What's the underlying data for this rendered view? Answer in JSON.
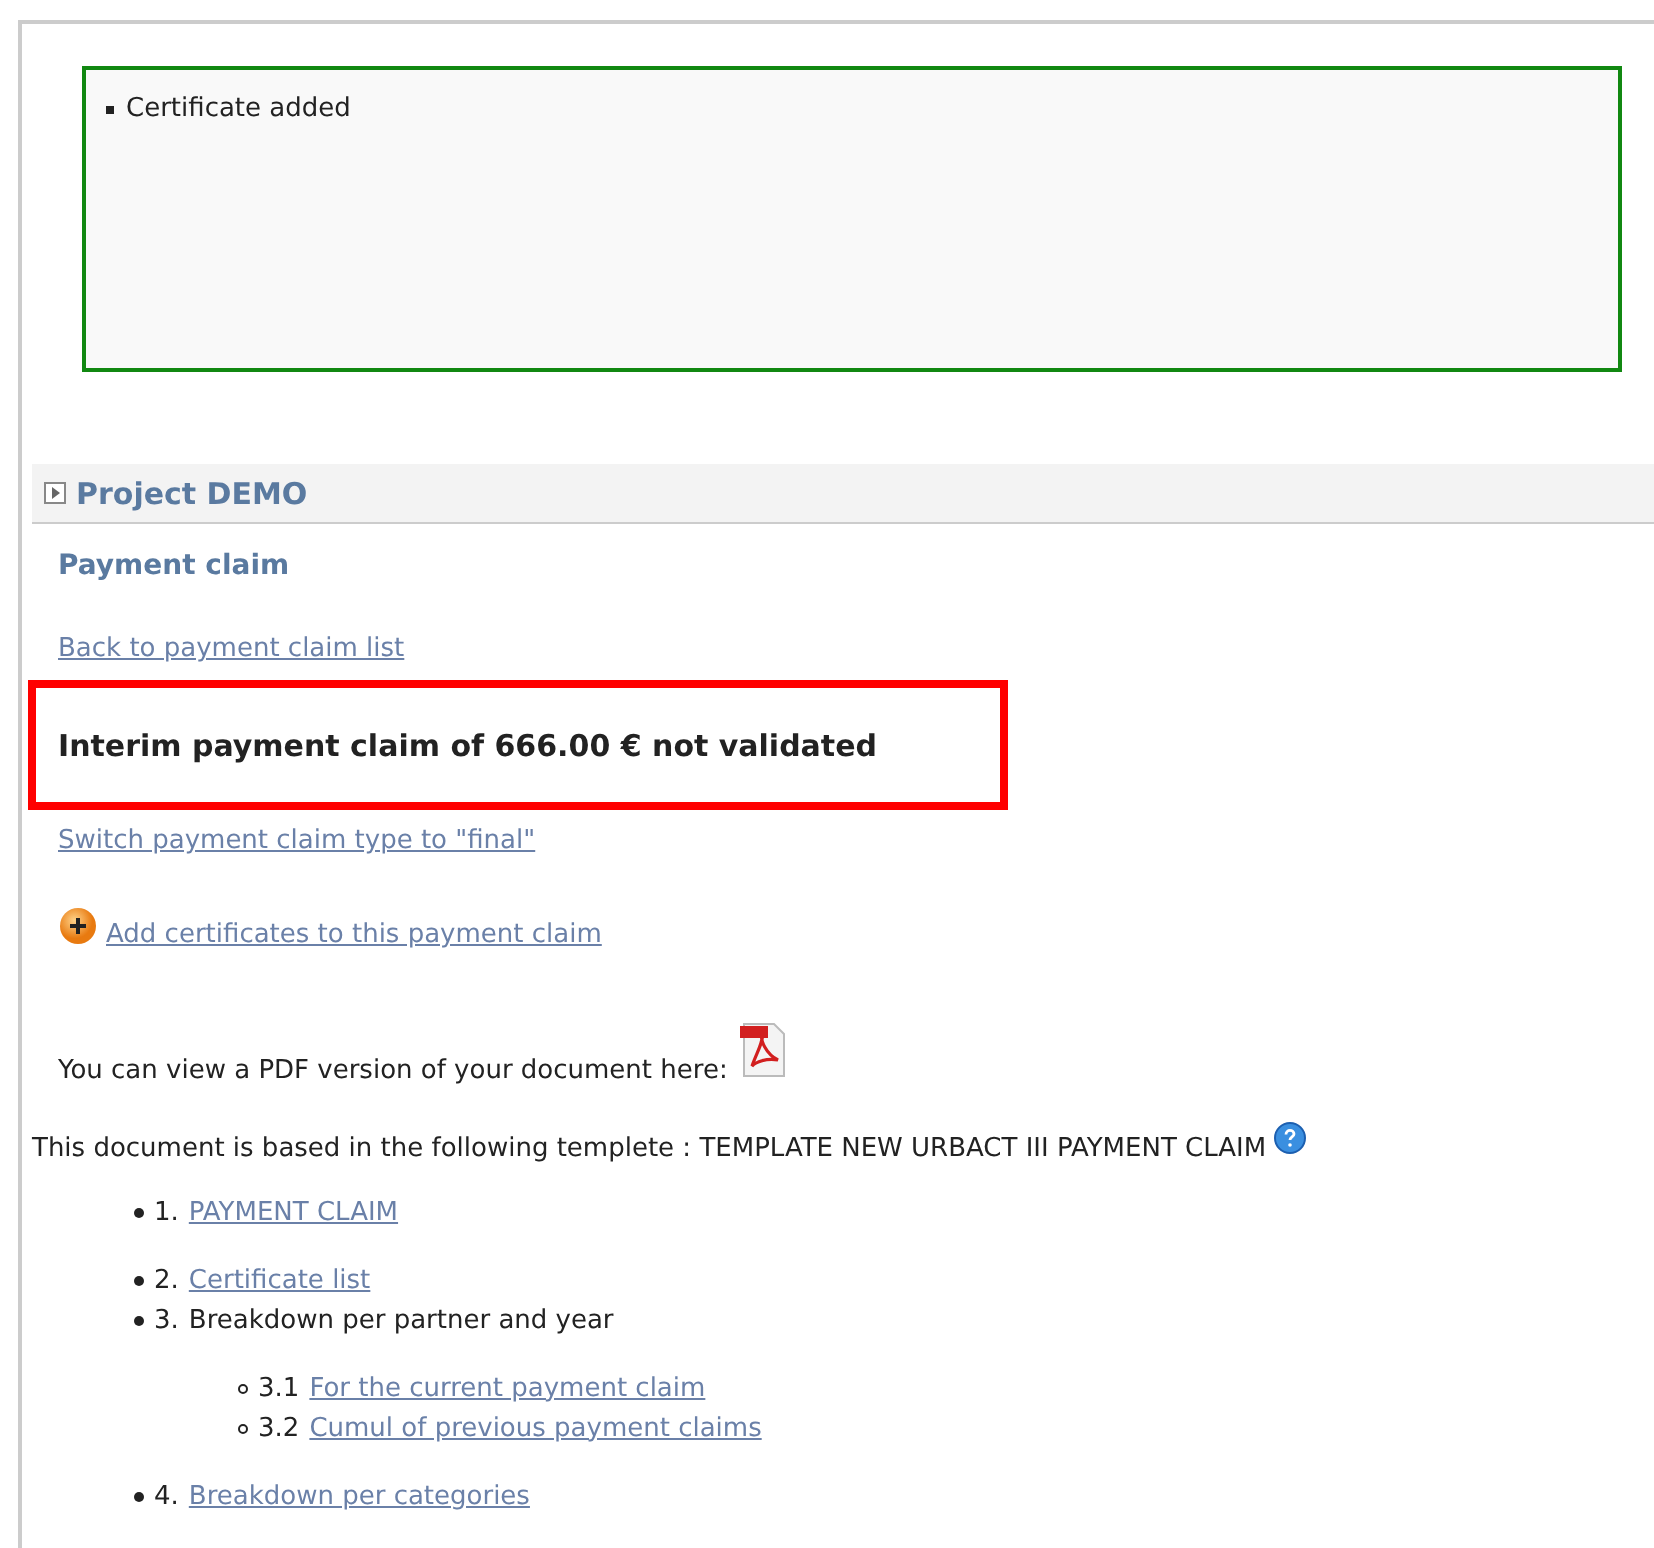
{
  "messages": [
    "Certificate added"
  ],
  "project": {
    "title": "Project DEMO",
    "expanded": false
  },
  "heading": "Payment claim",
  "back_link": "Back to payment claim list",
  "status": "Interim payment claim of 666.00 € not validated",
  "switch_link": "Switch payment claim type to \"final\"",
  "add_link": "Add certificates to this payment claim",
  "pdf_text": "You can view a PDF version of your document here:",
  "template_text": "This document is based in the following templete : TEMPLATE NEW URBACT III PAYMENT CLAIM",
  "sections": [
    {
      "number": "1.",
      "label": "PAYMENT CLAIM",
      "kind": "link"
    },
    {
      "number": "2.",
      "label": "Certificate list",
      "kind": "link"
    },
    {
      "number": "3.",
      "label": "Breakdown per partner and year",
      "kind": "text",
      "children": [
        {
          "number": "3.1",
          "label": "For the current payment claim",
          "kind": "link"
        },
        {
          "number": "3.2",
          "label": "Cumul of previous payment claims",
          "kind": "link"
        }
      ]
    },
    {
      "number": "4.",
      "label": "Breakdown per categories",
      "kind": "link"
    }
  ]
}
